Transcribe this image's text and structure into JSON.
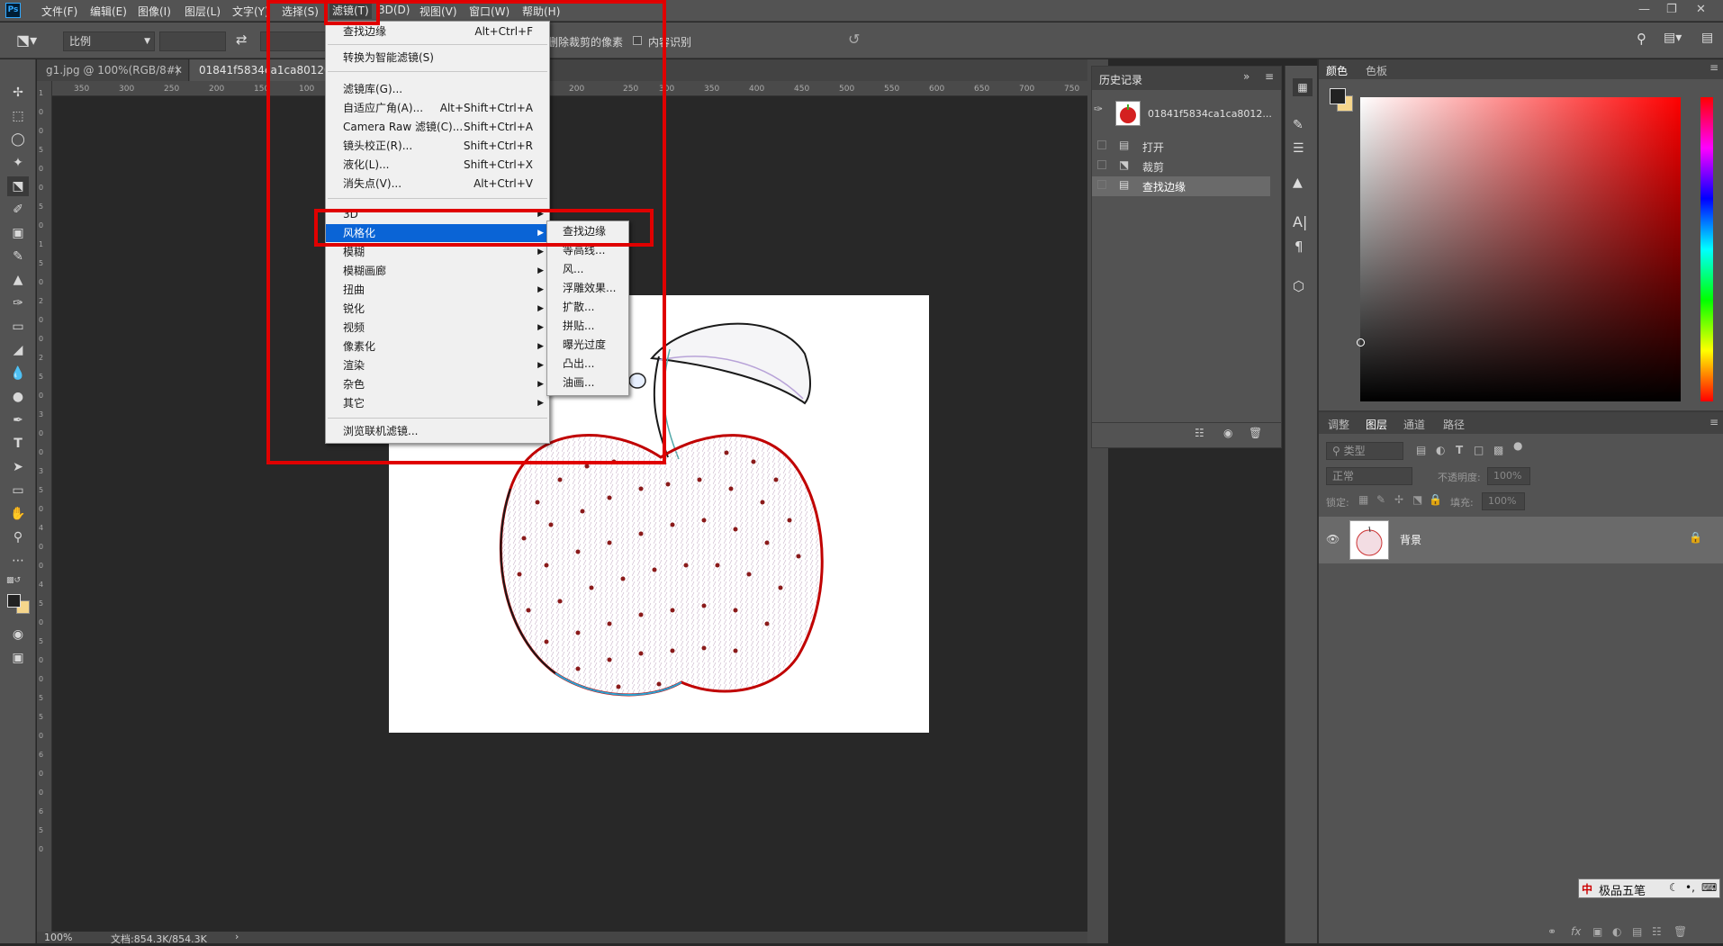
{
  "menubar": {
    "logo": "Ps",
    "items": [
      "文件(F)",
      "编辑(E)",
      "图像(I)",
      "图层(L)",
      "文字(Y)",
      "选择(S)",
      "滤镜(T)",
      "3D(D)",
      "视图(V)",
      "窗口(W)",
      "帮助(H)"
    ]
  },
  "options": {
    "ratio": "比例",
    "delete_cropped": "删除裁剪的像素",
    "content_aware": "内容识别"
  },
  "tabs": [
    "g1.jpg @ 100%(RGB/8#)",
    "01841f5834ca1ca801206"
  ],
  "ruler_h": [
    "350",
    "300",
    "250",
    "200",
    "150",
    "100",
    "200",
    "250",
    "300",
    "350",
    "400",
    "450",
    "500",
    "550",
    "600",
    "650",
    "700",
    "750"
  ],
  "ruler_v": [
    "1",
    "0",
    "0",
    "5",
    "0",
    "0",
    "5",
    "0",
    "1",
    "5",
    "0",
    "2",
    "0",
    "0",
    "2",
    "5",
    "0",
    "3",
    "0",
    "0",
    "3",
    "5",
    "0",
    "4",
    "0",
    "0",
    "4",
    "5",
    "0",
    "5",
    "0",
    "0",
    "5",
    "5",
    "0",
    "6",
    "0",
    "0",
    "6",
    "5",
    "0"
  ],
  "status": {
    "zoom": "100%",
    "doc": "文档:854.3K/854.3K"
  },
  "filter_menu": {
    "items": [
      {
        "label": "查找边缘",
        "shortcut": "Alt+Ctrl+F"
      },
      {
        "label": "转换为智能滤镜(S)",
        "shortcut": ""
      },
      {
        "label": "滤镜库(G)...",
        "shortcut": ""
      },
      {
        "label": "自适应广角(A)...",
        "shortcut": "Alt+Shift+Ctrl+A"
      },
      {
        "label": "Camera Raw 滤镜(C)...",
        "shortcut": "Shift+Ctrl+A"
      },
      {
        "label": "镜头校正(R)...",
        "shortcut": "Shift+Ctrl+R"
      },
      {
        "label": "液化(L)...",
        "shortcut": "Shift+Ctrl+X"
      },
      {
        "label": "消失点(V)...",
        "shortcut": "Alt+Ctrl+V"
      },
      {
        "label": "3D",
        "shortcut": ""
      },
      {
        "label": "风格化",
        "shortcut": ""
      },
      {
        "label": "模糊",
        "shortcut": ""
      },
      {
        "label": "模糊画廊",
        "shortcut": ""
      },
      {
        "label": "扭曲",
        "shortcut": ""
      },
      {
        "label": "锐化",
        "shortcut": ""
      },
      {
        "label": "视频",
        "shortcut": ""
      },
      {
        "label": "像素化",
        "shortcut": ""
      },
      {
        "label": "渲染",
        "shortcut": ""
      },
      {
        "label": "杂色",
        "shortcut": ""
      },
      {
        "label": "其它",
        "shortcut": ""
      },
      {
        "label": "浏览联机滤镜...",
        "shortcut": ""
      }
    ]
  },
  "stylize_submenu": [
    "查找边缘",
    "等高线...",
    "风...",
    "浮雕效果...",
    "扩散...",
    "拼贴...",
    "曝光过度",
    "凸出...",
    "油画..."
  ],
  "history": {
    "title": "历史记录",
    "snapshot": "01841f5834ca1ca8012...",
    "steps": [
      "打开",
      "裁剪",
      "查找边缘"
    ]
  },
  "color_panel": {
    "tabs": [
      "颜色",
      "色板"
    ]
  },
  "layers_panel": {
    "tabs": [
      "调整",
      "图层",
      "通道",
      "路径"
    ],
    "filter_kind": "类型",
    "blend_mode": "正常",
    "opacity_label": "不透明度:",
    "opacity_value": "100%",
    "lock_label": "锁定:",
    "fill_label": "填充:",
    "fill_value": "100%",
    "layer_name": "背景"
  },
  "ime": {
    "text": "极品五笔"
  },
  "colors": {
    "highlight": "#0a64d6",
    "annotation": "#e00000",
    "foreground": "#222222",
    "background": "#f6d68c"
  }
}
